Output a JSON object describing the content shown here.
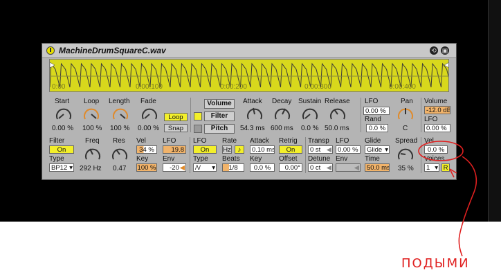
{
  "device": {
    "title": "MachineDrumSquareC.wav",
    "markers": [
      "0:00",
      "0:00:100",
      "0:00:200",
      "0:00:300",
      "0:00:400"
    ]
  },
  "row1": {
    "start": {
      "label": "Start",
      "value": "0.00 %"
    },
    "loop": {
      "label": "Loop",
      "value": "100 %"
    },
    "length": {
      "label": "Length",
      "value": "100 %"
    },
    "fade": {
      "label": "Fade",
      "value": "0.00 %"
    },
    "loop_btn": "Loop",
    "snap_btn": "Snap",
    "volume_btn": "Volume",
    "filter_btn": "Filter",
    "pitch_btn": "Pitch",
    "attack": {
      "label": "Attack",
      "value": "54.3 ms"
    },
    "decay": {
      "label": "Decay",
      "value": "600 ms"
    },
    "sustain": {
      "label": "Sustain",
      "value": "0.0 %"
    },
    "release": {
      "label": "Release",
      "value": "50.0 ms"
    },
    "lfo_label": "LFO",
    "lfo_value": "0.00 %",
    "rand_label": "Rand",
    "rand_value": "0.0 %",
    "pan": {
      "label": "Pan",
      "value": "C"
    },
    "volume_label": "Volume",
    "volume_value": "-12.0 dB",
    "vlfo_label": "LFO",
    "vlfo_value": "0.00 %"
  },
  "row2": {
    "filter_label": "Filter",
    "filter_on": "On",
    "type_label": "Type",
    "type_value": "BP12",
    "freq": {
      "label": "Freq",
      "value": "292 Hz"
    },
    "res": {
      "label": "Res",
      "value": "0.47"
    },
    "vel_label": "Vel",
    "vel_value": "34 %",
    "key_label": "Key",
    "key_value": "100 %",
    "lfo2_label": "LFO",
    "lfo2_value": "19.8",
    "env_label": "Env",
    "env_value": "-20",
    "lfo3_label": "LFO",
    "lfo3_on": "On",
    "type3_label": "Type",
    "rate_label": "Rate",
    "rate_hz": "Hz",
    "rate_note": "♪",
    "beats_label": "Beats",
    "beats_value": "1/8",
    "attack2_label": "Attack",
    "attack2_value": "0.10 ms",
    "key2_label": "Key",
    "key2_value": "0.0 %",
    "retrig_label": "Retrig",
    "retrig_on": "On",
    "offset_label": "Offset",
    "offset_value": "0.00°",
    "transp_label": "Transp",
    "transp_value": "0 st",
    "lfo4_label": "LFO",
    "lfo4_value": "0.00 %",
    "detune_label": "Detune",
    "detune_value": "0 ct",
    "env2_label": "Env",
    "glide_label": "Glide",
    "glide_value": "Glide",
    "time_label": "Time",
    "time_value": "50.0 ms",
    "spread": {
      "label": "Spread",
      "value": "35 %"
    },
    "vel2_label": "Vel",
    "vel2_value": "0.0 %",
    "voices_label": "Voices",
    "voices_value": "1",
    "r_btn": "R"
  },
  "annotation": {
    "text": "ПОДЫМИ",
    "color": "#e02020"
  }
}
